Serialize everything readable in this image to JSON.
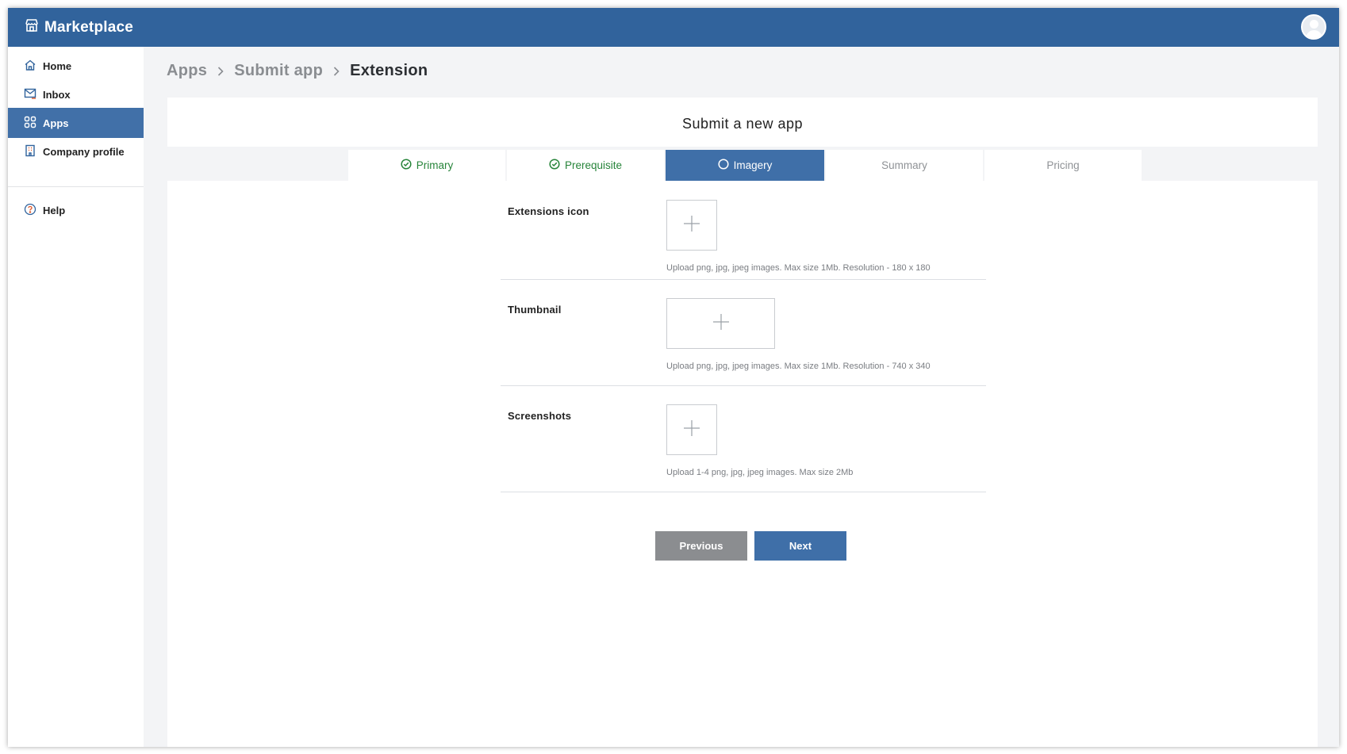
{
  "app": {
    "title": "Marketplace"
  },
  "sidebar": {
    "items": [
      {
        "label": "Home",
        "icon": "home-icon"
      },
      {
        "label": "Inbox",
        "icon": "inbox-icon"
      },
      {
        "label": "Apps",
        "icon": "apps-grid-icon",
        "active": true
      },
      {
        "label": "Company profile",
        "icon": "building-icon"
      }
    ],
    "footer_items": [
      {
        "label": "Help",
        "icon": "help-icon"
      }
    ]
  },
  "breadcrumb": [
    "Apps",
    "Submit app",
    "Extension"
  ],
  "page": {
    "title": "Submit a new app"
  },
  "tabs": [
    {
      "label": "Primary",
      "state": "done"
    },
    {
      "label": "Prerequisite",
      "state": "done"
    },
    {
      "label": "Imagery",
      "state": "active"
    },
    {
      "label": "Summary",
      "state": "pending"
    },
    {
      "label": "Pricing",
      "state": "pending"
    }
  ],
  "form": {
    "sections": [
      {
        "label": "Extensions icon",
        "hint": "Upload png, jpg, jpeg images. Max size 1Mb. Resolution - 180 x 180"
      },
      {
        "label": "Thumbnail",
        "hint": "Upload png, jpg, jpeg images. Max size 1Mb. Resolution - 740 x 340"
      },
      {
        "label": "Screenshots",
        "hint": "Upload 1-4 png, jpg, jpeg images. Max size 2Mb"
      }
    ]
  },
  "buttons": {
    "previous": "Previous",
    "next": "Next"
  },
  "colors": {
    "topbar": "#31639c",
    "active": "#3f6fa8",
    "done": "#27843a",
    "secondary_button": "#8b8d90"
  }
}
